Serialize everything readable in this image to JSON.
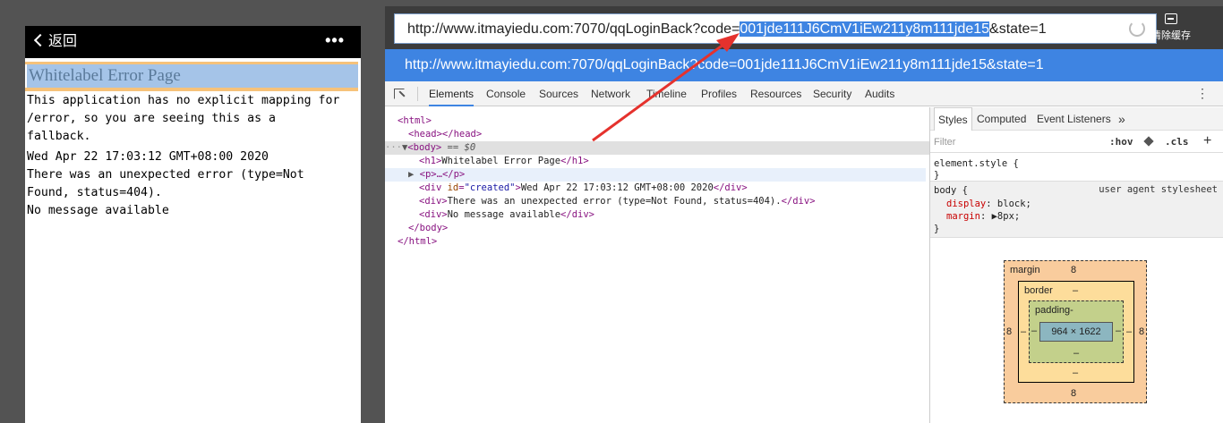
{
  "phone": {
    "back_label": "返回",
    "more_label": "•••",
    "page_title": "Whitelabel Error Page",
    "paragraph": "This application has no explicit mapping for /error, so you are seeing this as a fallback.",
    "created": "Wed Apr 22 17:03:12 GMT+08:00 2020",
    "error_text": "There was an unexpected error (type=Not Found, status=404).",
    "no_message": "No message available"
  },
  "browser": {
    "url_prefix": "http://www.itmayiedu.com:7070/qqLoginBack?code=",
    "url_code": "001jde111J6CmV1iEw211y8m111jde15",
    "url_suffix": "&state=1",
    "suggestion": "http://www.itmayiedu.com:7070/qqLoginBack?code=001jde111J6CmV1iEw211y8m111jde15&state=1",
    "clear_cache_label": "清除缓存"
  },
  "devtools": {
    "tabs": [
      "Elements",
      "Console",
      "Sources",
      "Network",
      "Timeline",
      "Profiles",
      "Resources",
      "Security",
      "Audits"
    ],
    "active_tab": "Elements",
    "tree": {
      "html_open": "<html>",
      "head": "<head></head>",
      "body_open": "<body>",
      "body_suffix": " == $0",
      "h1_open": "<h1>",
      "h1_text": "Whitelabel Error Page",
      "h1_close": "</h1>",
      "p_collapsed": "<p>…</p>",
      "div_created_open": "<div ",
      "div_created_attr": "id",
      "div_created_val": "\"created\"",
      "div_created_text": "Wed Apr 22 17:03:12 GMT+08:00 2020",
      "div_close": "</div>",
      "div_open": "<div>",
      "div_error_text": "There was an unexpected error (type=Not Found, status=404).",
      "div_nomsg_text": "No message available",
      "body_close": "</body>",
      "html_close": "</html>"
    },
    "styles": {
      "tabs": [
        "Styles",
        "Computed",
        "Event Listeners"
      ],
      "more_tabs": "»",
      "filter_placeholder": "Filter",
      "hov": ":hov",
      "cls": ".cls",
      "plus": "+",
      "element_style": "element.style {",
      "close_brace": "}",
      "body_selector": "body {",
      "ua_label": "user agent stylesheet",
      "prop1_name": "display",
      "prop1_val": "block;",
      "prop2_name": "margin",
      "prop2_val": "8px;",
      "prop2_arrow": "▶"
    },
    "box_model": {
      "margin_label": "margin",
      "margin_top": "8",
      "margin_bottom": "8",
      "margin_left": "8",
      "margin_right": "8",
      "border_label": "border",
      "border_top": "–",
      "border_bottom": "–",
      "border_left": "–",
      "border_right": "–",
      "padding_label": "padding-",
      "padding_bottom": "–",
      "padding_left": "–",
      "padding_right": "–",
      "content_size": "964 × 1622"
    }
  },
  "colors": {
    "highlight": "#3e84e2",
    "arrow": "#e5322d"
  }
}
